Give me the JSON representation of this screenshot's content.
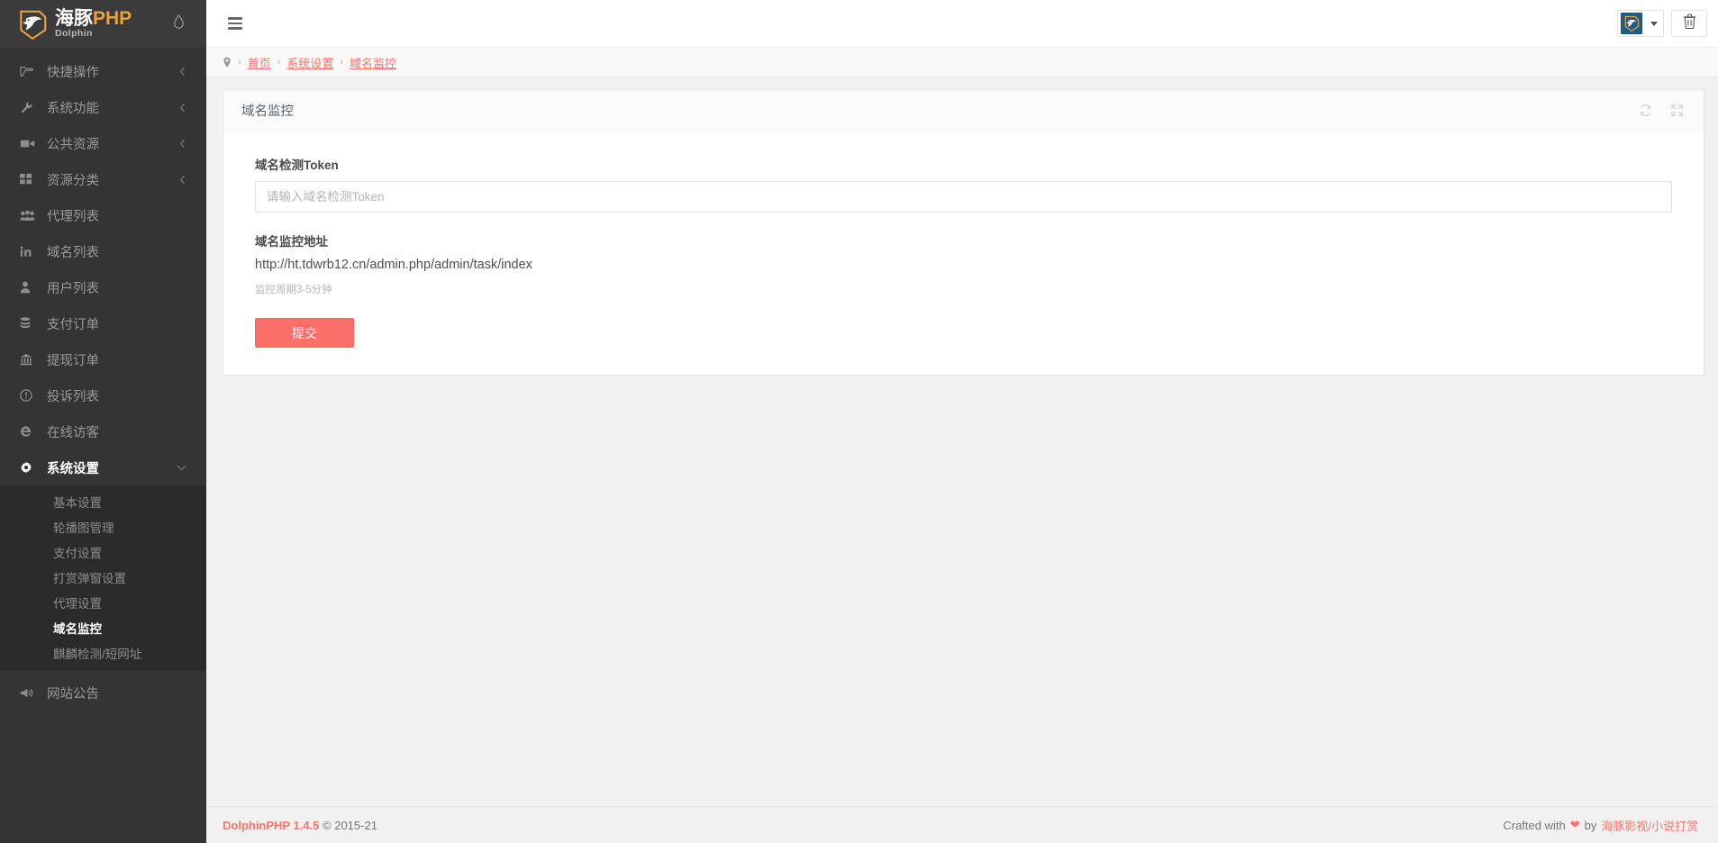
{
  "brand": {
    "logo_cn": "海豚",
    "logo_php": "PHP",
    "logo_sub": "Dolphin",
    "logo_icon": "dolphin-logo-icon",
    "drop_icon": "water-drop-icon"
  },
  "colors": {
    "accent": "#f9746a",
    "submit": "#fa6f68",
    "sidebar_bg": "#343434",
    "submenu_bg": "#2b2b2b",
    "avatar_bg": "#1c5c85",
    "logo_orange": "#e8a33d"
  },
  "sidebar": {
    "items": [
      {
        "label": "快捷操作",
        "icon": "folder-open-icon",
        "expandable": true,
        "active": false
      },
      {
        "label": "系统功能",
        "icon": "wrench-icon",
        "expandable": true,
        "active": false
      },
      {
        "label": "公共资源",
        "icon": "video-camera-icon",
        "expandable": true,
        "active": false
      },
      {
        "label": "资源分类",
        "icon": "grid-squares-icon",
        "expandable": true,
        "active": false
      },
      {
        "label": "代理列表",
        "icon": "users-group-icon",
        "expandable": false,
        "active": false
      },
      {
        "label": "域名列表",
        "icon": "linkedin-in-icon",
        "expandable": false,
        "active": false
      },
      {
        "label": "用户列表",
        "icon": "user-icon",
        "expandable": false,
        "active": false
      },
      {
        "label": "支付订单",
        "icon": "database-icon",
        "expandable": false,
        "active": false
      },
      {
        "label": "提现订单",
        "icon": "bank-icon",
        "expandable": false,
        "active": false
      },
      {
        "label": "投诉列表",
        "icon": "exclamation-circle-icon",
        "expandable": false,
        "active": false
      },
      {
        "label": "在线访客",
        "icon": "edge-browser-icon",
        "expandable": false,
        "active": false
      },
      {
        "label": "系统设置",
        "icon": "gear-icon",
        "expandable": true,
        "active": true
      }
    ],
    "submenu": [
      {
        "label": "基本设置",
        "active": false
      },
      {
        "label": "轮播图管理",
        "active": false
      },
      {
        "label": "支付设置",
        "active": false
      },
      {
        "label": "打赏弹窗设置",
        "active": false
      },
      {
        "label": "代理设置",
        "active": false
      },
      {
        "label": "域名监控",
        "active": true
      },
      {
        "label": "麒麟检测/短网址",
        "active": false
      }
    ],
    "trailing": [
      {
        "label": "网站公告",
        "icon": "megaphone-icon",
        "expandable": false,
        "active": false
      }
    ]
  },
  "topbar": {
    "menu_toggle_icon": "hamburger-menu-icon",
    "avatar_icon": "dolphin-avatar-icon",
    "dropdown_icon": "caret-down-icon",
    "trash_icon": "trash-can-icon"
  },
  "breadcrumb": {
    "pin_icon": "location-pin-icon",
    "separator": "›",
    "items": [
      "首页",
      "系统设置",
      "域名监控"
    ]
  },
  "panel": {
    "title": "域名监控",
    "refresh_icon": "refresh-icon",
    "fullscreen_icon": "expand-fullscreen-icon"
  },
  "form": {
    "token_label": "域名检测Token",
    "token_value": "",
    "token_placeholder": "请输入域名检测Token",
    "url_label": "域名监控地址",
    "url_value": "http://ht.tdwrb12.cn/admin.php/admin/task/index",
    "hint": "监控周期3-5分钟",
    "submit_label": "提交"
  },
  "footer": {
    "brand": "DolphinPHP 1.4.5",
    "copyright": "© 2015-21",
    "crafted_prefix": "Crafted with",
    "heart": "❤",
    "by": "by",
    "author": "海豚影视/小说打赏"
  }
}
